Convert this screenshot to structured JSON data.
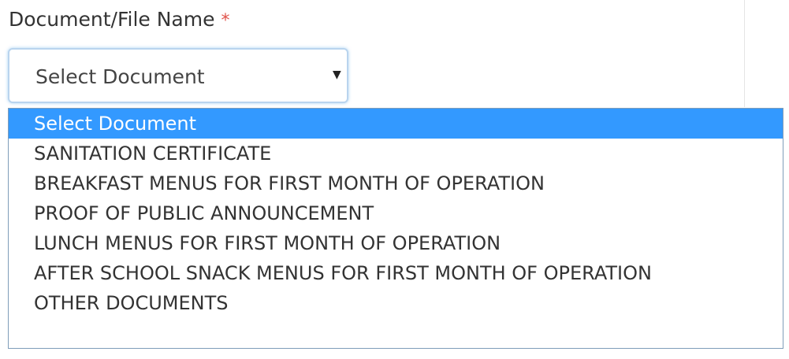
{
  "form": {
    "label": "Document/File Name",
    "required_marker": "*"
  },
  "select": {
    "selected_value": "Select Document",
    "caret_icon": "triangle-down-icon",
    "caret_glyph": "▼"
  },
  "dropdown": {
    "options": [
      "Select Document",
      "SANITATION CERTIFICATE",
      "BREAKFAST MENUS FOR FIRST MONTH OF OPERATION",
      "PROOF OF PUBLIC ANNOUNCEMENT",
      "LUNCH MENUS FOR FIRST MONTH OF OPERATION",
      "AFTER SCHOOL SNACK MENUS FOR FIRST MONTH OF OPERATION",
      "OTHER DOCUMENTS"
    ],
    "highlight_color": "#3399ff",
    "highlighted_index": 0
  },
  "colors": {
    "required_star": "#e0534b",
    "focus_border": "#b9d4ee",
    "list_border": "#7f9db9"
  }
}
